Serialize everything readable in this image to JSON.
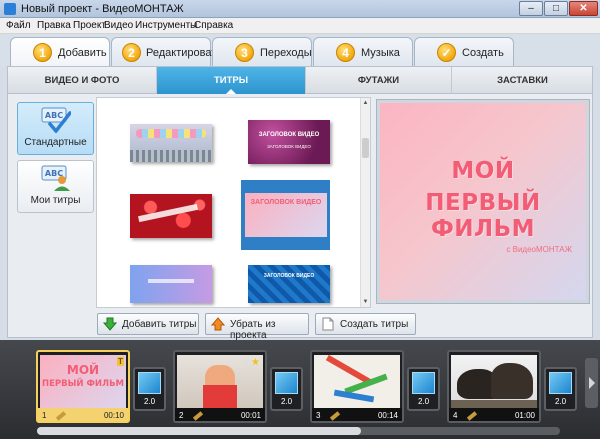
{
  "window": {
    "title": "Новый проект - ВидеоМОНТАЖ",
    "minimize": "–",
    "maximize": "□",
    "close": "✕"
  },
  "menu": [
    "Файл",
    "Правка",
    "Проект",
    "Видео",
    "Инструменты",
    "Справка"
  ],
  "steps": [
    {
      "num": "1",
      "label": "Добавить",
      "active": true
    },
    {
      "num": "2",
      "label": "Редактировать",
      "active": false
    },
    {
      "num": "3",
      "label": "Переходы",
      "active": false
    },
    {
      "num": "4",
      "label": "Музыка",
      "active": false
    },
    {
      "num": "✓",
      "label": "Создать",
      "active": false
    }
  ],
  "subtabs": [
    "ВИДЕО И ФОТО",
    "ТИТРЫ",
    "ФУТАЖИ",
    "ЗАСТАВКИ"
  ],
  "active_subtab": "ТИТРЫ",
  "categories": [
    {
      "label": "Стандартные",
      "icon": "abc-check-icon",
      "active": true
    },
    {
      "label": "Мои титры",
      "icon": "abc-user-icon",
      "active": false
    }
  ],
  "titles": [
    {
      "line1": "",
      "line2": "",
      "style": "pastel-bubbles",
      "selected": false
    },
    {
      "line1": "ЗАГОЛОВОК ВИДЕО",
      "line2": "ЗАГОЛОВОК ВИДЕО",
      "style": "purple-sparkle",
      "selected": false
    },
    {
      "line1": "",
      "line2": "",
      "style": "strawberries",
      "selected": false
    },
    {
      "line1": "ЗАГОЛОВОК ВИДЕО",
      "line2": "",
      "style": "pink-gradient",
      "selected": true
    },
    {
      "line1": "",
      "line2": "",
      "style": "blue-purple",
      "selected": false
    },
    {
      "line1": "ЗАГОЛОВОК ВИДЕО",
      "line2": "",
      "style": "blue-diagonal",
      "selected": false
    }
  ],
  "preview": {
    "line1": "МОЙ",
    "line2": "ПЕРВЫЙ ФИЛЬМ",
    "subtitle": "с ВидеоМОНТАЖ"
  },
  "actions": {
    "add": "Добавить титры",
    "remove": "Убрать из проекта",
    "create": "Создать титры"
  },
  "timeline": {
    "clips": [
      {
        "index": "1",
        "duration": "00:10",
        "kind": "title",
        "text1": "МОЙ",
        "text2": "ПЕРВЫЙ ФИЛЬМ"
      },
      {
        "index": "2",
        "duration": "00:01",
        "kind": "photo-child"
      },
      {
        "index": "3",
        "duration": "00:14",
        "kind": "photo-crafts"
      },
      {
        "index": "4",
        "duration": "01:00",
        "kind": "photo-birds"
      }
    ],
    "transitions": [
      "2.0",
      "2.0",
      "2.0",
      "2.0"
    ],
    "scroll_fraction": 0.62
  },
  "colors": {
    "accent": "#2d94cf",
    "step_badge": "#f3a70f",
    "selected_clip": "#f6d25a",
    "preview_text": "#f25d75"
  }
}
